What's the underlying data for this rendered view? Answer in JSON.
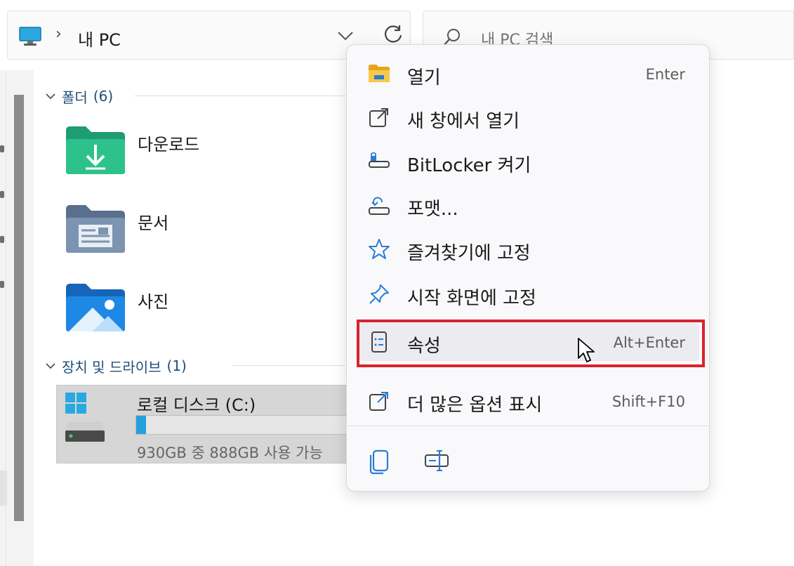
{
  "address_bar": {
    "location_icon": "monitor-icon",
    "separator": "›",
    "crumb": "내 PC",
    "dropdown_icon": "chevron-down-icon",
    "refresh_icon": "refresh-icon"
  },
  "search": {
    "placeholder": "내 PC 검색",
    "icon": "search-icon"
  },
  "groups": {
    "folders": {
      "title": "폴더",
      "count": "(6)"
    },
    "devices": {
      "title": "장치 및 드라이브",
      "count": "(1)"
    }
  },
  "folders": [
    {
      "name": "다운로드",
      "icon": "downloads-folder-icon"
    },
    {
      "name": "문서",
      "icon": "documents-folder-icon"
    },
    {
      "name": "사진",
      "icon": "pictures-folder-icon"
    }
  ],
  "drive": {
    "name": "로컬 디스크 (C:)",
    "free_text": "930GB 중 888GB 사용 가능",
    "used_fraction": 0.045,
    "icon": "local-disk-icon",
    "bar_color": "#26a0da"
  },
  "context_menu": {
    "items": [
      {
        "label": "열기",
        "shortcut": "Enter",
        "icon": "folder-open-icon"
      },
      {
        "label": "새 창에서 열기",
        "shortcut": "",
        "icon": "open-new-window-icon"
      },
      {
        "label": "BitLocker 켜기",
        "shortcut": "",
        "icon": "bitlocker-icon"
      },
      {
        "label": "포맷...",
        "shortcut": "",
        "icon": "format-drive-icon"
      },
      {
        "label": "즐겨찾기에 고정",
        "shortcut": "",
        "icon": "star-icon"
      },
      {
        "label": "시작 화면에 고정",
        "shortcut": "",
        "icon": "pin-icon"
      },
      {
        "label": "속성",
        "shortcut": "Alt+Enter",
        "icon": "properties-icon"
      },
      {
        "label": "더 많은 옵션 표시",
        "shortcut": "Shift+F10",
        "icon": "more-options-icon"
      }
    ],
    "command_bar": [
      {
        "icon": "copy-icon"
      },
      {
        "icon": "rename-icon"
      }
    ],
    "highlighted_item": "속성",
    "highlight_color": "#d9232d"
  },
  "colors": {
    "accent": "#0078d4",
    "group_header": "#1f4e79",
    "menu_bg": "#f9f9fc"
  }
}
